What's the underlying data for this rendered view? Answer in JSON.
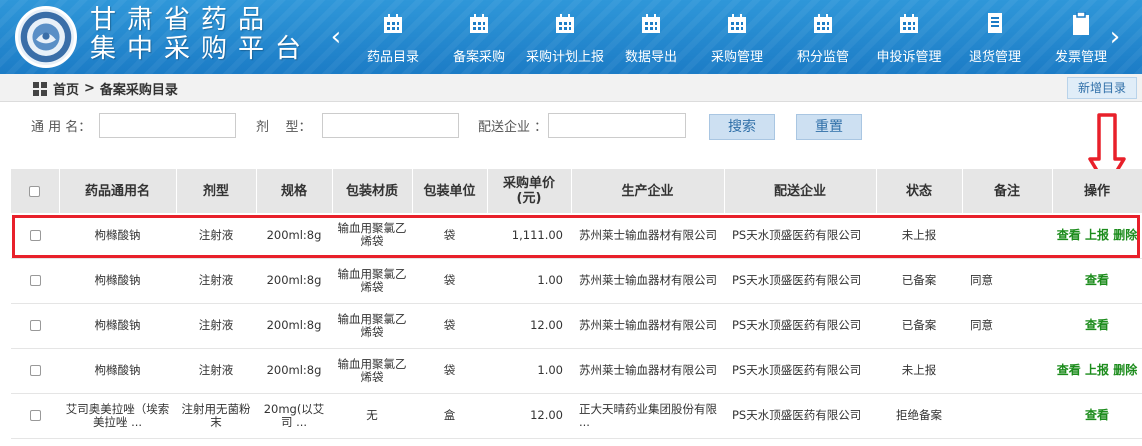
{
  "header": {
    "brand_line1": "甘肃省药品",
    "brand_line2": "集中采购平台",
    "nav": [
      {
        "label": "药品目录",
        "icon": "calendar-icon"
      },
      {
        "label": "备案采购",
        "icon": "calendar-icon"
      },
      {
        "label": "采购计划上报",
        "icon": "calendar-icon"
      },
      {
        "label": "数据导出",
        "icon": "calendar-icon"
      },
      {
        "label": "采购管理",
        "icon": "calendar-icon"
      },
      {
        "label": "积分监管",
        "icon": "calendar-icon"
      },
      {
        "label": "申投诉管理",
        "icon": "calendar-icon"
      },
      {
        "label": "退货管理",
        "icon": "document-icon"
      },
      {
        "label": "发票管理",
        "icon": "clipboard-icon"
      }
    ]
  },
  "breadcrumb": {
    "home": "首页",
    "sep": ">",
    "current": "备案采购目录"
  },
  "add_button": "新增目录",
  "search": {
    "generic_label": "通 用 名：",
    "dosage_label": "剂    型：",
    "distributor_label": "配送企业 ：",
    "generic_value": "",
    "dosage_value": "",
    "distributor_value": "",
    "search_btn": "搜索",
    "reset_btn": "重置"
  },
  "table": {
    "headers": [
      "",
      "药品通用名",
      "剂型",
      "规格",
      "包装材质",
      "包装单位",
      "采购单价\n(元)",
      "生产企业",
      "配送企业",
      "状态",
      "备注",
      "操作"
    ],
    "rows": [
      {
        "name": "枸橼酸钠",
        "form": "注射液",
        "spec": "200ml:8g",
        "material": "输血用聚氯乙烯袋",
        "unit": "袋",
        "price": "1,111.00",
        "maker": "苏州莱士输血器材有限公司",
        "distributor": "PS天水顶盛医药有限公司",
        "status": "未上报",
        "note": "",
        "ops": [
          "查看",
          "上报",
          "删除"
        ]
      },
      {
        "name": "枸橼酸钠",
        "form": "注射液",
        "spec": "200ml:8g",
        "material": "输血用聚氯乙烯袋",
        "unit": "袋",
        "price": "1.00",
        "maker": "苏州莱士输血器材有限公司",
        "distributor": "PS天水顶盛医药有限公司",
        "status": "已备案",
        "note": "同意",
        "ops": [
          "查看"
        ]
      },
      {
        "name": "枸橼酸钠",
        "form": "注射液",
        "spec": "200ml:8g",
        "material": "输血用聚氯乙烯袋",
        "unit": "袋",
        "price": "12.00",
        "maker": "苏州莱士输血器材有限公司",
        "distributor": "PS天水顶盛医药有限公司",
        "status": "已备案",
        "note": "同意",
        "ops": [
          "查看"
        ]
      },
      {
        "name": "枸橼酸钠",
        "form": "注射液",
        "spec": "200ml:8g",
        "material": "输血用聚氯乙烯袋",
        "unit": "袋",
        "price": "1.00",
        "maker": "苏州莱士输血器材有限公司",
        "distributor": "PS天水顶盛医药有限公司",
        "status": "未上报",
        "note": "",
        "ops": [
          "查看",
          "上报",
          "删除"
        ]
      },
      {
        "name": "艾司奥美拉唑（埃索美拉唑 ...",
        "form": "注射用无菌粉末",
        "spec": "20mg(以艾司 ...",
        "material": "无",
        "unit": "盒",
        "price": "12.00",
        "maker": "正大天晴药业集团股份有限 ...",
        "distributor": "PS天水顶盛医药有限公司",
        "status": "拒绝备案",
        "note": "",
        "ops": [
          "查看"
        ]
      }
    ]
  },
  "colors": {
    "header_blue": "#1c7cc6",
    "op_green": "#1c8c1c",
    "highlight_red": "#e8202a"
  }
}
